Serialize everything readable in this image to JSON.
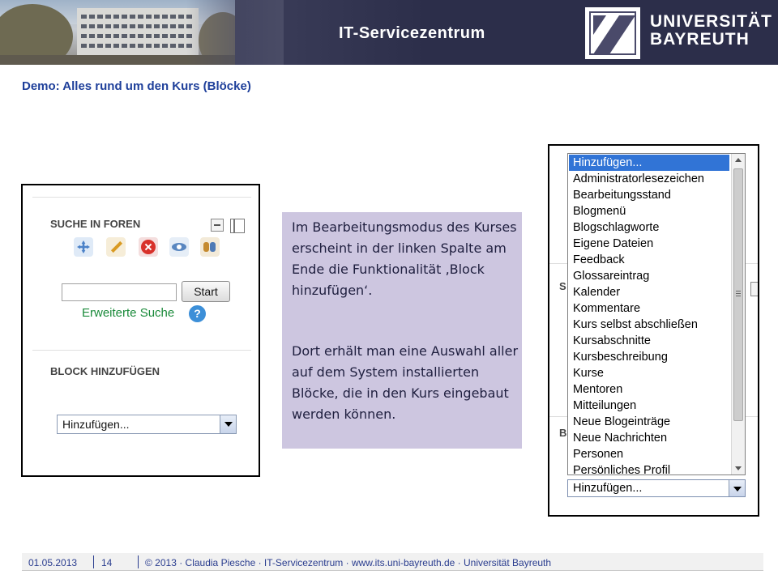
{
  "header": {
    "title": "IT-Servicezentrum",
    "university_line1": "UNIVERSITÄT",
    "university_line2": "BAYREUTH"
  },
  "slide_title": "Demo: Alles rund um den Kurs (Blöcke)",
  "left_screenshot": {
    "block1_heading": "SUCHE IN FOREN",
    "search_value": "",
    "start_button": "Start",
    "advanced_search_link": "Erweiterte Suche",
    "help_icon_glyph": "?",
    "block2_heading": "BLOCK HINZUFÜGEN",
    "select_value": "Hinzufügen...",
    "icons": [
      "move-icon",
      "edit-icon",
      "delete-icon",
      "hide-icon",
      "roles-icon"
    ]
  },
  "callout": {
    "paragraph1": "Im Bearbeitungsmodus des Kurses erscheint in der linken Spalte am Ende die Funktionalität ‚Block hinzufügen‘.",
    "paragraph2": "Dort erhält man eine Auswahl aller auf dem System installierten Blöcke, die in den Kurs eingebaut werden können.",
    "background_color": "#cdc6e0"
  },
  "right_screenshot": {
    "background_heading_s": "S",
    "background_heading_b": "B",
    "options": [
      "Hinzufügen...",
      "Administratorlesezeichen",
      "Bearbeitungsstand",
      "Blogmenü",
      "Blogschlagworte",
      "Eigene Dateien",
      "Feedback",
      "Glossareintrag",
      "Kalender",
      "Kommentare",
      "Kurs selbst abschließen",
      "Kursabschnitte",
      "Kursbeschreibung",
      "Kurse",
      "Mentoren",
      "Mitteilungen",
      "Neue Blogeinträge",
      "Neue Nachrichten",
      "Personen",
      "Persönliches Profil"
    ],
    "selected_index": 0,
    "select_value": "Hinzufügen...",
    "selection_color": "#3174d6"
  },
  "footer": {
    "date": "01.05.2013",
    "page": "14",
    "copyright": "© 2013 · Claudia Piesche · IT-Servicezentrum · www.its.uni-bayreuth.de · Universität Bayreuth"
  }
}
